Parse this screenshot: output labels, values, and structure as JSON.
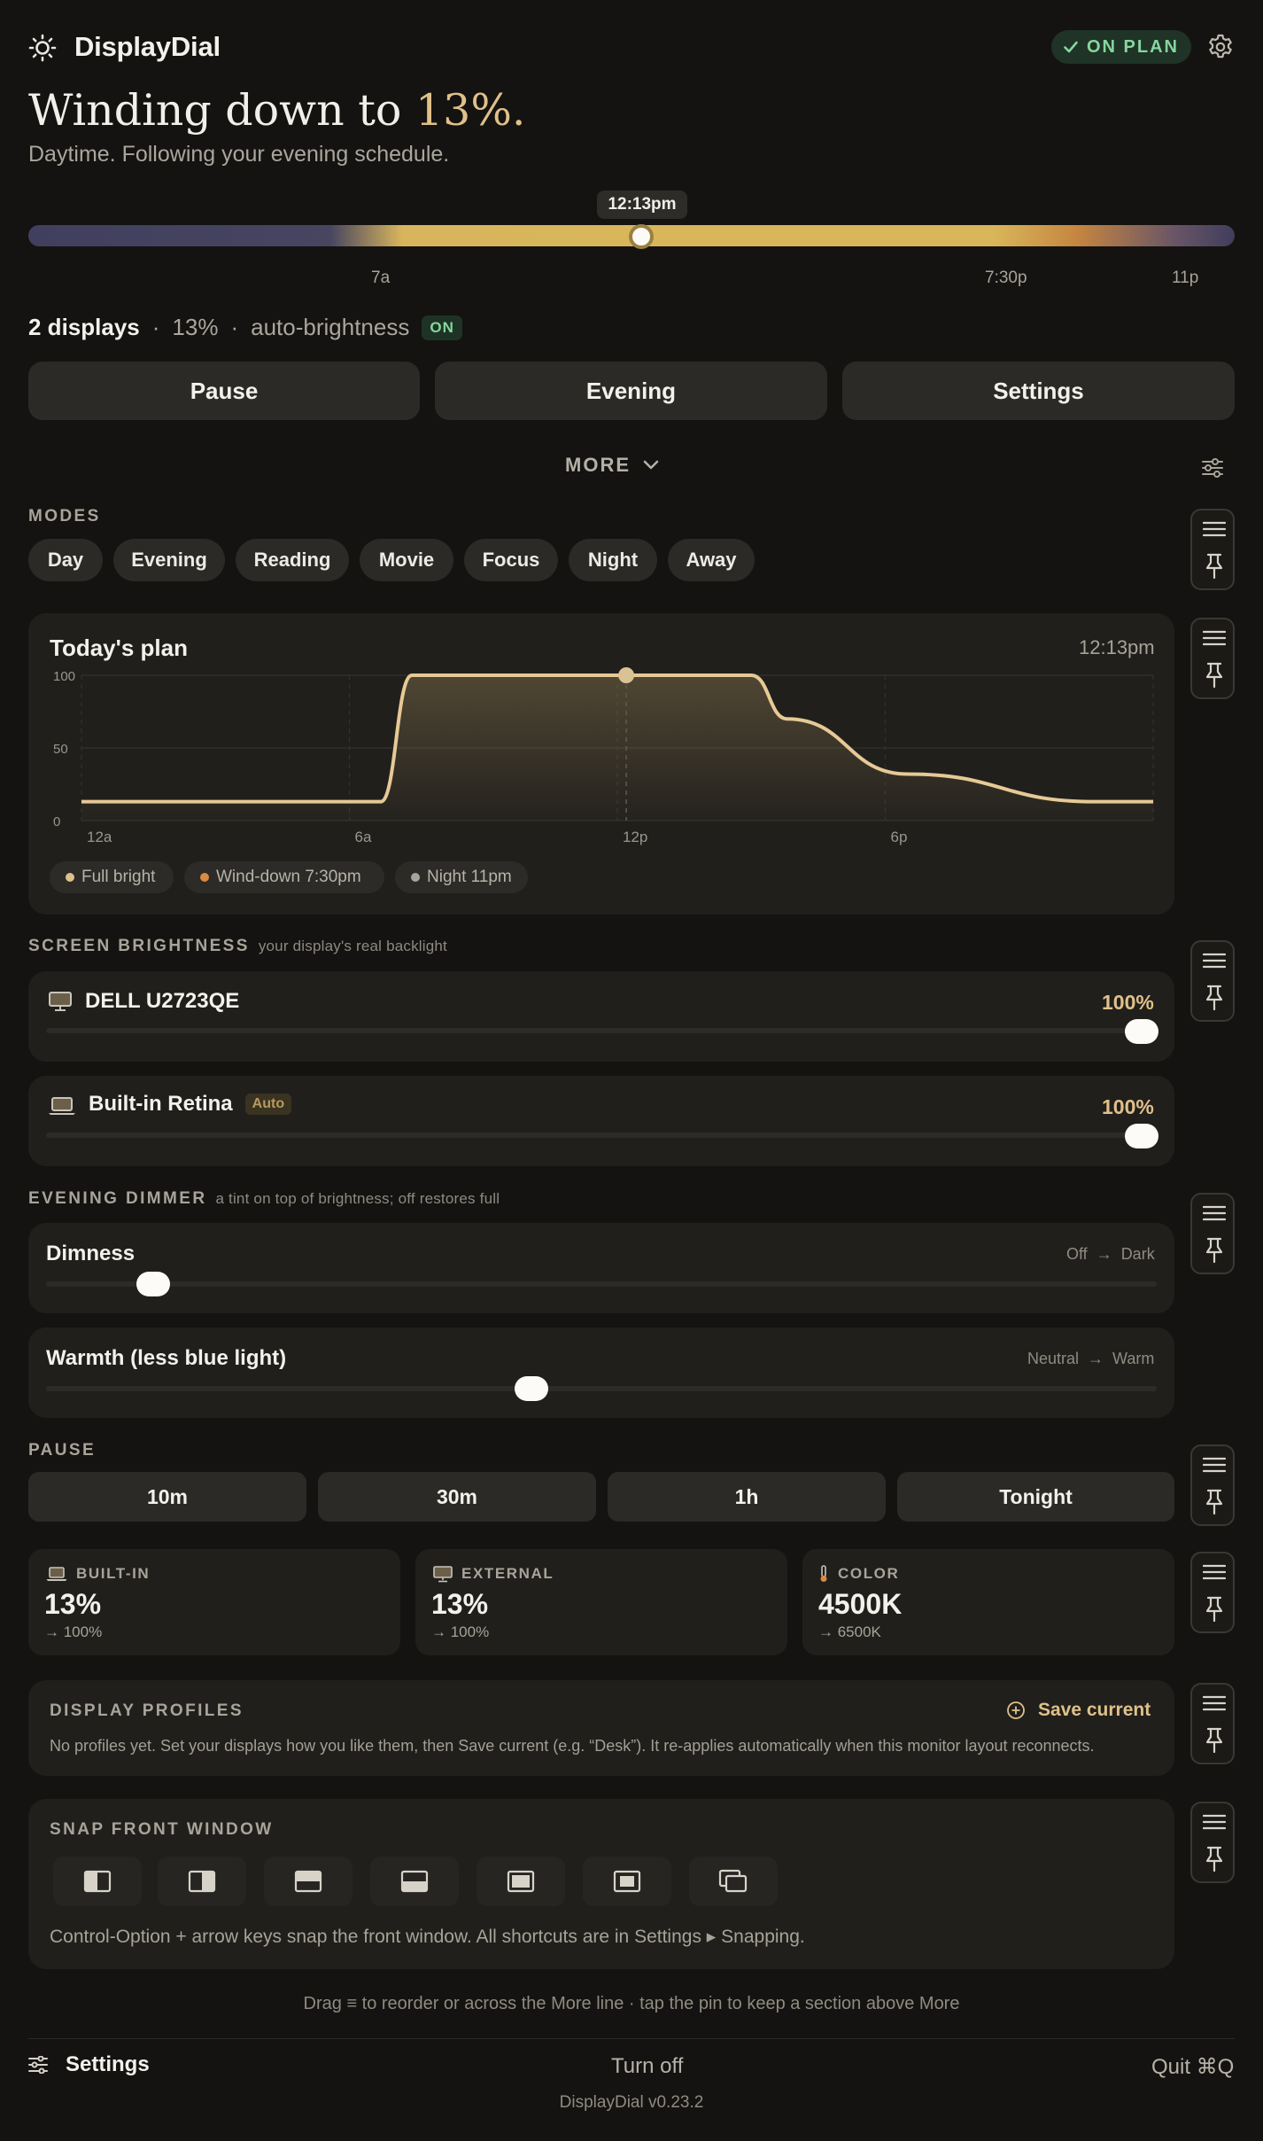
{
  "app": {
    "title": "DisplayDial",
    "plan_badge": "ON PLAN"
  },
  "hero": {
    "headline_prefix": "Winding down to",
    "headline_pct": "13%.",
    "subhead": "Daytime. Following your evening schedule."
  },
  "timeline": {
    "now_label": "12:13pm",
    "labels": [
      "7a",
      "7:30p",
      "11p"
    ],
    "now_fraction": 0.508
  },
  "summary": {
    "displays": "2 displays",
    "sep": "·",
    "level": "13%",
    "feature": "auto-brightness",
    "badge": "ON"
  },
  "actions": {
    "pause": "Pause",
    "evening": "Evening",
    "settings": "Settings"
  },
  "more": {
    "label": "MORE"
  },
  "modes": {
    "heading": "MODES",
    "items": [
      "Day",
      "Evening",
      "Reading",
      "Movie",
      "Focus",
      "Night",
      "Away"
    ]
  },
  "plan": {
    "title": "Today's plan",
    "now": "12:13pm",
    "legend": [
      "Full bright",
      "Wind-down 7:30pm",
      "Night 11pm"
    ],
    "legend_colors": [
      "#e0c08a",
      "#d98a45",
      "#a8a49a"
    ],
    "line_color": "#e6c995"
  },
  "chart_data": {
    "type": "line",
    "title": "Today's plan",
    "xlabel": "",
    "ylabel": "",
    "x_ticks": [
      "12a",
      "6a",
      "12p",
      "6p"
    ],
    "y_ticks": [
      "100",
      "50",
      "0"
    ],
    "xlim": [
      0,
      24
    ],
    "ylim": [
      0,
      100
    ],
    "grid": true,
    "series": [
      {
        "x": [
          0,
          6.7,
          7.4,
          15.0,
          15.8,
          18.5,
          22.7,
          24
        ],
        "y": [
          13,
          13,
          100,
          100,
          70,
          32,
          13,
          13
        ]
      }
    ],
    "marker": {
      "x": 12.2,
      "y": 100
    }
  },
  "brightness": {
    "heading": "SCREEN BRIGHTNESS",
    "sub": "your display's real backlight",
    "displays": [
      {
        "name": "DELL U2723QE",
        "value": "100%",
        "level": 1.0,
        "tag": ""
      },
      {
        "name": "Built-in Retina",
        "value": "100%",
        "level": 1.0,
        "tag": "Auto"
      }
    ]
  },
  "dimmer": {
    "heading": "EVENING DIMMER",
    "sub": "a tint on top of brightness; off restores full",
    "dimness": {
      "name": "Dimness",
      "from": "Off",
      "to": "Dark",
      "level": 0.1
    },
    "warmth": {
      "name": "Warmth (less blue light)",
      "from": "Neutral",
      "to": "Warm",
      "level": 0.46
    }
  },
  "pause": {
    "heading": "PAUSE",
    "options": [
      "10m",
      "30m",
      "1h",
      "Tonight"
    ]
  },
  "stats": [
    {
      "label": "BUILT-IN",
      "value": "13%",
      "target": "→ 100%",
      "icon": "laptop-icon"
    },
    {
      "label": "EXTERNAL",
      "value": "13%",
      "target": "→ 100%",
      "icon": "monitor-icon"
    },
    {
      "label": "COLOR",
      "value": "4500K",
      "target": "→ 6500K",
      "icon": "thermometer-icon"
    }
  ],
  "profiles": {
    "heading": "DISPLAY PROFILES",
    "save": "Save current",
    "desc": "No profiles yet. Set your displays how you like them, then Save current (e.g. “Desk”). It re-applies automatically when this monitor layout reconnects."
  },
  "snap": {
    "heading": "SNAP FRONT WINDOW",
    "desc": "Control-Option + arrow keys snap the front window. All shortcuts are in Settings ▸ Snapping."
  },
  "footer": {
    "hint": "Drag ≡ to reorder or across the More line · tap the pin to keep a section above More",
    "settings": "Settings",
    "turn_off": "Turn off",
    "quit": "Quit  ⌘Q",
    "version": "DisplayDial v0.23.2"
  },
  "colors": {
    "accent": "#e0c08a",
    "on": "#86d69e",
    "bg": "#141311",
    "card": "#201f1c"
  }
}
